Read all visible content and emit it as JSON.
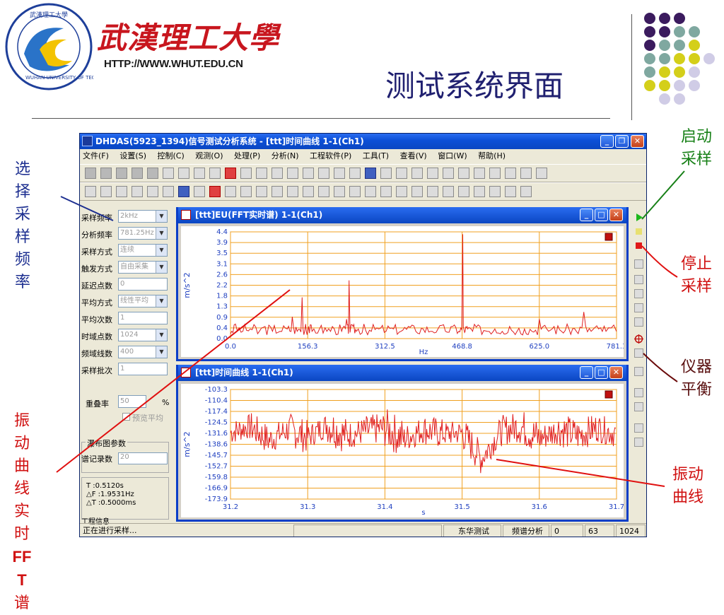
{
  "slide": {
    "university_name": "武漢理工大學",
    "university_url": "HTTP://WWW.WHUT.EDU.CN",
    "seal_text_top": "武漢理工大學",
    "seal_text_ring": "WUHAN UNIVERSITY OF TECHNOLOGY",
    "title": "测试系统界面",
    "colors": {
      "title": "#202070",
      "brand_red": "#c8161e",
      "dot_purple": "#3b1b5e",
      "dot_teal": "#7fa8a0",
      "dot_yellow": "#d4cf1a",
      "dot_lavender": "#d0cce6"
    }
  },
  "callouts": {
    "select_freq": "选择采样频率",
    "fft_prefix": "振动曲线实时",
    "fft_latin": "FFT",
    "fft_suffix": "谱",
    "start": "启动采样",
    "stop": "停止采样",
    "balance": "仪器平衡",
    "curve": "振动曲线"
  },
  "app": {
    "title": "DHDAS(5923_1394)信号测试分析系统  - [ttt]时间曲线  1-1(Ch1)",
    "window_buttons": {
      "min": "_",
      "restore": "❐",
      "close": "✕"
    },
    "menu": [
      "文件(F)",
      "设置(S)",
      "控制(C)",
      "观测(O)",
      "处理(P)",
      "分析(N)",
      "工程软件(P)",
      "工具(T)",
      "查看(V)",
      "窗口(W)",
      "帮助(H)"
    ],
    "params": [
      {
        "label": "采样频率",
        "value": "2kHz",
        "dropdown": true
      },
      {
        "label": "分析频率",
        "value": "781.25Hz",
        "dropdown": true
      },
      {
        "label": "采样方式",
        "value": "连续",
        "dropdown": true
      },
      {
        "label": "触发方式",
        "value": "自由采集",
        "dropdown": true
      },
      {
        "label": "延迟点数",
        "value": "0",
        "dropdown": false
      },
      {
        "label": "平均方式",
        "value": "线性平均",
        "dropdown": true
      },
      {
        "label": "平均次数",
        "value": "1",
        "dropdown": false
      },
      {
        "label": "时域点数",
        "value": "1024",
        "dropdown": true
      },
      {
        "label": "频域线数",
        "value": "400",
        "dropdown": true
      },
      {
        "label": "采样批次",
        "value": "1",
        "dropdown": false
      }
    ],
    "overlap": {
      "label": "重叠率",
      "value": "50",
      "unit": "%"
    },
    "preview": {
      "label": "预览平均",
      "checked": false
    },
    "waterfall": {
      "title": "瀑布图参数",
      "spectra_label": "谱记录数",
      "spectra_value": "20"
    },
    "readout": {
      "T": "T :0.5120s",
      "dF": "△F :1.9531Hz",
      "dT": "△T :0.5000ms"
    },
    "project_info_label": "工程信息",
    "status": {
      "message": "正在进行采样...",
      "vendor": "东华测试",
      "mode": "频谱分析",
      "field1": "0",
      "field2": "63",
      "field3": "1024"
    }
  },
  "fft_window": {
    "title": "[ttt]EU(FFT实时谱)  1-1(Ch1)"
  },
  "time_window": {
    "title": "[ttt]时间曲线  1-1(Ch1)"
  },
  "chart_data": [
    {
      "type": "line",
      "title": "[ttt]EU(FFT实时谱)  1-1(Ch1)",
      "xlabel": "Hz",
      "ylabel": "m/s^2",
      "xlim": [
        0,
        781.3
      ],
      "ylim": [
        0,
        4.4
      ],
      "x_ticks": [
        "0.0",
        "156.3",
        "312.5",
        "468.8",
        "625.0",
        "781.3"
      ],
      "y_ticks": [
        "4.4",
        "3.9",
        "3.5",
        "3.1",
        "2.6",
        "2.2",
        "1.8",
        "1.3",
        "0.9",
        "0.4",
        "0.0"
      ],
      "grid": true,
      "color": "#e02020",
      "series": [
        {
          "x": [
            0,
            10,
            25,
            40,
            55,
            70,
            85,
            100,
            115,
            125,
            135,
            145,
            152,
            158,
            165,
            180,
            195,
            210,
            225,
            235,
            240,
            248,
            255,
            270,
            285,
            300,
            315,
            330,
            345,
            360,
            375,
            390,
            405,
            420,
            435,
            450,
            462,
            470,
            475,
            480,
            490,
            505,
            520,
            535,
            550,
            565,
            580,
            595,
            610,
            625,
            640,
            655,
            670,
            685,
            700,
            715,
            730,
            745,
            760,
            781
          ],
          "y": [
            0.2,
            0.6,
            0.3,
            0.4,
            0.2,
            0.5,
            0.3,
            0.3,
            0.4,
            0.9,
            0.3,
            1.7,
            0.6,
            0.5,
            0.3,
            0.4,
            0.3,
            0.4,
            0.3,
            0.8,
            2.4,
            0.5,
            0.3,
            0.6,
            0.3,
            0.4,
            0.3,
            0.4,
            0.3,
            0.5,
            0.3,
            0.4,
            0.3,
            0.4,
            0.3,
            0.5,
            0.3,
            4.3,
            0.3,
            0.4,
            0.3,
            0.5,
            0.3,
            0.4,
            0.3,
            0.5,
            0.3,
            0.4,
            0.3,
            0.8,
            0.4,
            0.5,
            0.3,
            0.4,
            0.3,
            1.1,
            0.3,
            0.4,
            0.3,
            0.3
          ]
        }
      ]
    },
    {
      "type": "line",
      "title": "[ttt]时间曲线  1-1(Ch1)",
      "xlabel": "s",
      "ylabel": "m/s^2",
      "xlim": [
        31.2,
        31.7
      ],
      "ylim": [
        -173.9,
        -103.3
      ],
      "x_ticks": [
        "31.2",
        "31.3",
        "31.4",
        "31.5",
        "31.6",
        "31.7"
      ],
      "y_ticks": [
        "-103.3",
        "-110.4",
        "-117.4",
        "-124.5",
        "-131.6",
        "-138.6",
        "-145.7",
        "-152.7",
        "-159.8",
        "-166.9",
        "-173.9"
      ],
      "grid": true,
      "color": "#e02020",
      "series": [
        {
          "x": [
            31.2,
            31.225,
            31.25,
            31.275,
            31.3,
            31.325,
            31.35,
            31.375,
            31.4,
            31.425,
            31.45,
            31.475,
            31.5,
            31.525,
            31.55,
            31.575,
            31.6,
            31.625,
            31.65,
            31.675,
            31.7
          ],
          "y": [
            -131,
            -127,
            -136,
            -129,
            -134,
            -126,
            -133,
            -130,
            -128,
            -135,
            -129,
            -132,
            -131,
            -148,
            -130,
            -127,
            -135,
            -129,
            -133,
            -128,
            -132
          ],
          "spread": [
            8,
            10,
            9,
            11,
            8,
            12,
            9,
            10,
            13,
            9,
            10,
            8,
            11,
            9,
            10,
            12,
            9,
            11,
            10,
            9,
            8
          ]
        }
      ]
    }
  ]
}
